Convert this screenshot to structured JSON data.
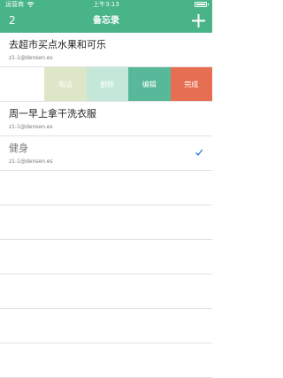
{
  "status_bar": {
    "carrier": "运营商",
    "time": "上午3:13"
  },
  "nav": {
    "count": "2",
    "title": "备忘录"
  },
  "notes": [
    {
      "title": "去超市买点水果和可乐",
      "sub": "z1-1@densen.es"
    },
    {
      "title": "周一早上拿干洗衣服",
      "sub": "z1-1@densen.es"
    },
    {
      "title": "健身",
      "sub": "z1-1@densen.es",
      "done": true
    }
  ],
  "swipe_actions": [
    {
      "label": "电话",
      "color": "#dde6c6"
    },
    {
      "label": "删除",
      "color": "#c3e8d9"
    },
    {
      "label": "编辑",
      "color": "#58b99a"
    },
    {
      "label": "完成",
      "color": "#e76f51"
    }
  ],
  "colors": {
    "accent": "#48b487",
    "check": "#2f7bd8"
  }
}
